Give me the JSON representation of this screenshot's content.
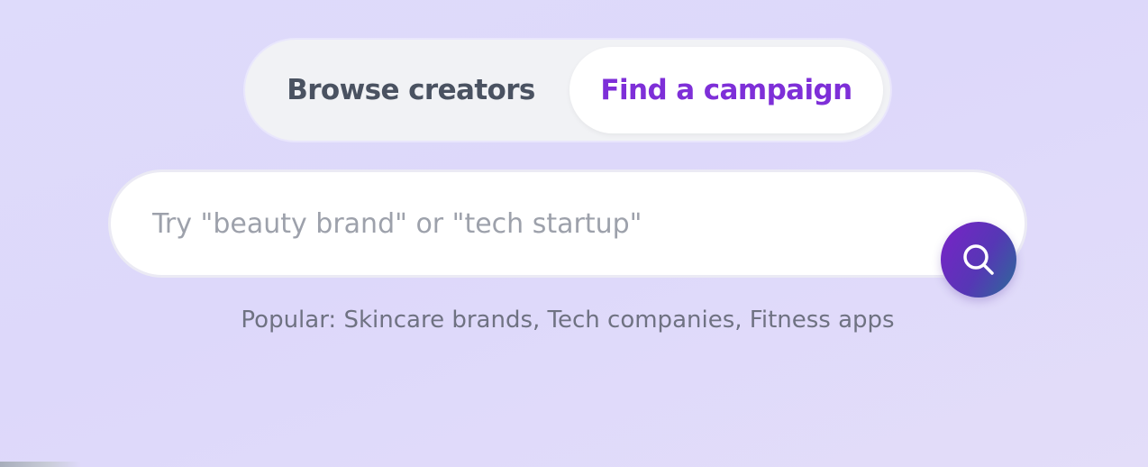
{
  "mode_toggle": {
    "browse_label": "Browse creators",
    "find_label": "Find a campaign",
    "active": "find"
  },
  "search": {
    "placeholder": "Try \"beauty brand\" or \"tech startup\"",
    "value": "",
    "button_icon": "search-icon"
  },
  "popular": {
    "prefix": "Popular:",
    "items": [
      "Skincare brands",
      "Tech companies",
      "Fitness apps"
    ]
  },
  "colors": {
    "accent": "#7e2fd8",
    "tab_inactive_text": "#4a5261",
    "background": "#dedbfb",
    "search_button_start": "#7a22c8",
    "search_button_end": "#2b6c98"
  }
}
